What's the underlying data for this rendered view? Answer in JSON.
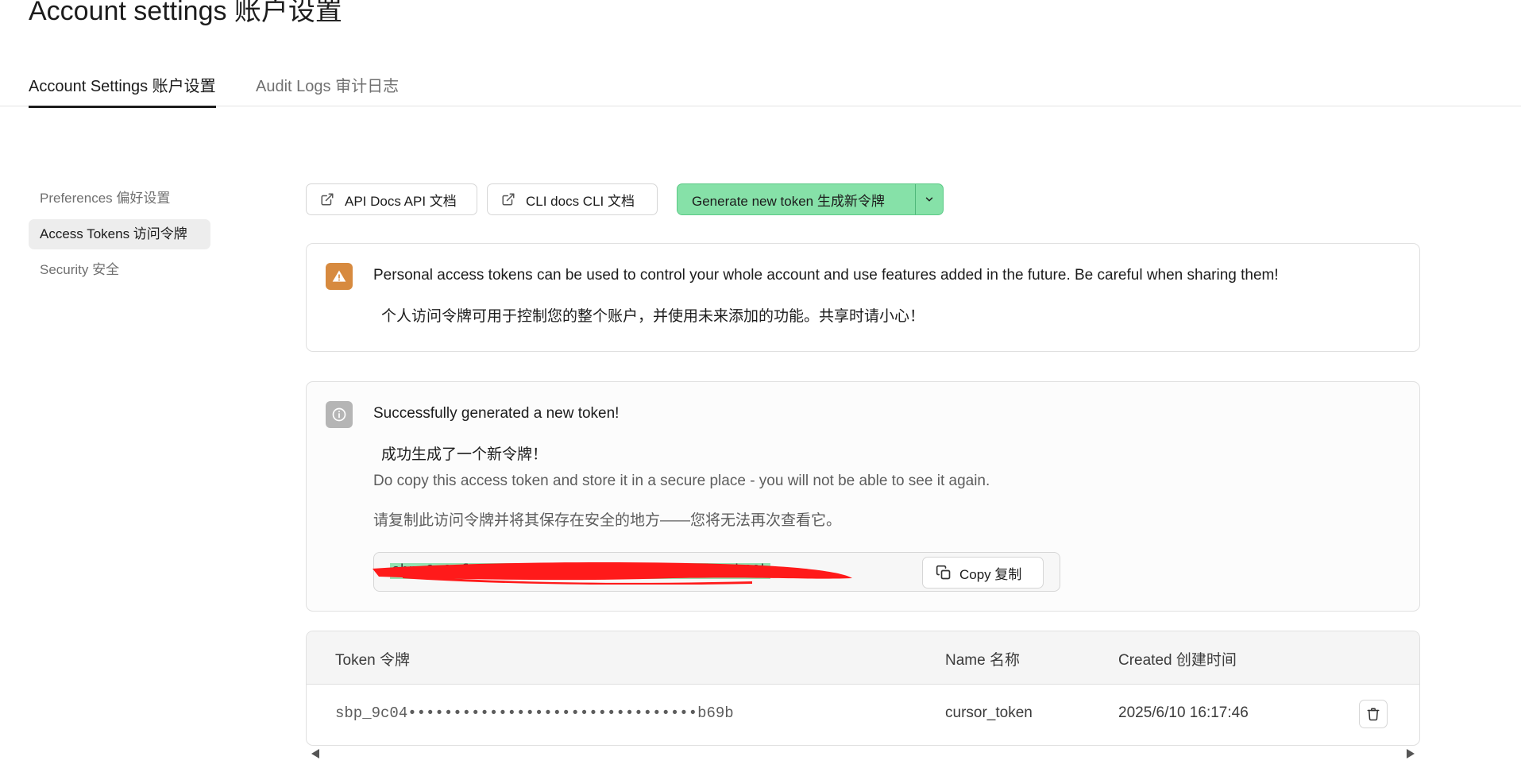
{
  "page": {
    "title": "Account settings  账户设置"
  },
  "tabs": [
    {
      "label": "Account Settings  账户设置"
    },
    {
      "label": "Audit Logs  审计日志"
    }
  ],
  "sidebar": {
    "items": [
      {
        "label": "Preferences  偏好设置"
      },
      {
        "label": "Access Tokens  访问令牌"
      },
      {
        "label": "Security  安全"
      }
    ]
  },
  "toolbar": {
    "api_docs_label": "API Docs  API 文档",
    "cli_docs_label": "CLI docs  CLI 文档",
    "generate_label": "Generate new token  生成新令牌"
  },
  "warning": {
    "text_en": "Personal access tokens can be used to control your whole account and use features added in the future. Be careful when sharing them!",
    "text_zh": "个人访问令牌可用于控制您的整个账户，并使用未来添加的功能。共享时请小心！"
  },
  "success": {
    "title_en": "Successfully generated a new token!",
    "title_zh": "成功生成了一个新令牌！",
    "desc_en": "Do copy this access token and store it in a secure place - you will not be able to see it again.",
    "desc_zh": "请复制此访问令牌并将其保存在安全的地方——您将无法再次查看它。",
    "token_value": "sbp_9c04f8a5d1f8a2e7c3b1d9e6f0a4c2b7d5e8b69b",
    "copy_label": "Copy  复制"
  },
  "table": {
    "headers": [
      "Token  令牌",
      "Name  名称",
      "Created  创建时间"
    ],
    "rows": [
      {
        "token": "sbp_9c04••••••••••••••••••••••••••••••••b69b",
        "name": "cursor_token",
        "created": "2025/6/10 16:17:46"
      }
    ]
  },
  "colors": {
    "accent_green": "#86e1a8",
    "warning_orange": "#d78a3f",
    "info_gray": "#b5b5b5",
    "redaction_red": "#ff1a1a"
  },
  "icons": {
    "external_link": "external-link-icon",
    "chevron_down": "chevron-down-icon",
    "warning": "warning-icon",
    "info": "info-icon",
    "copy": "copy-icon",
    "trash": "trash-icon"
  }
}
